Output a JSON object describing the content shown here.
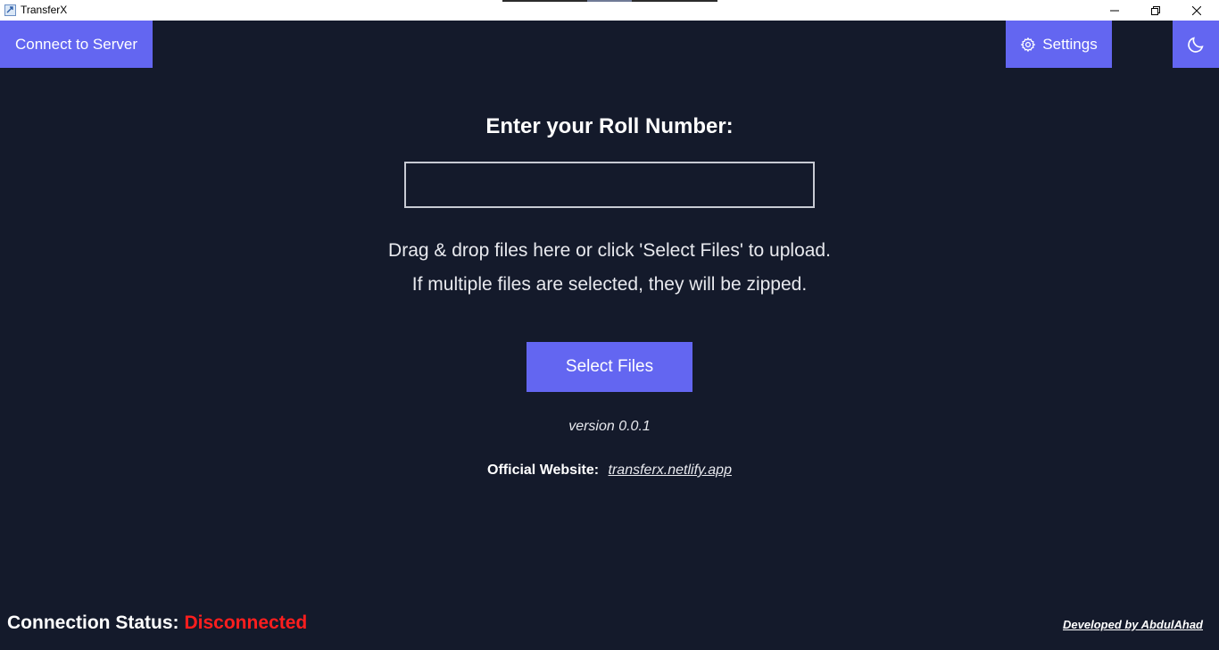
{
  "window": {
    "title": "TransferX",
    "icon": "transferx-app-icon",
    "controls": [
      "minimize-icon",
      "restore-icon",
      "close-icon"
    ]
  },
  "toolbar": {
    "connect_label": "Connect to Server",
    "settings_label": "Settings",
    "settings_icon": "gear-icon",
    "theme_icon": "moon-icon"
  },
  "main": {
    "heading": "Enter your Roll Number:",
    "roll_input_value": "",
    "instruction_line1": "Drag & drop files here or click 'Select Files' to upload.",
    "instruction_line2": "If multiple files are selected, they will be zipped.",
    "select_files_label": "Select Files",
    "version": "version 0.0.1",
    "website_label": "Official Website:",
    "website_link": "transferx.netlify.app"
  },
  "footer": {
    "status_label": "Connection Status:",
    "status_value": "Disconnected",
    "developer": "Developed by AbdulAhad"
  },
  "colors": {
    "background": "#141a2b",
    "accent": "#6366f1",
    "status_disconnected": "#ff1e1e"
  }
}
